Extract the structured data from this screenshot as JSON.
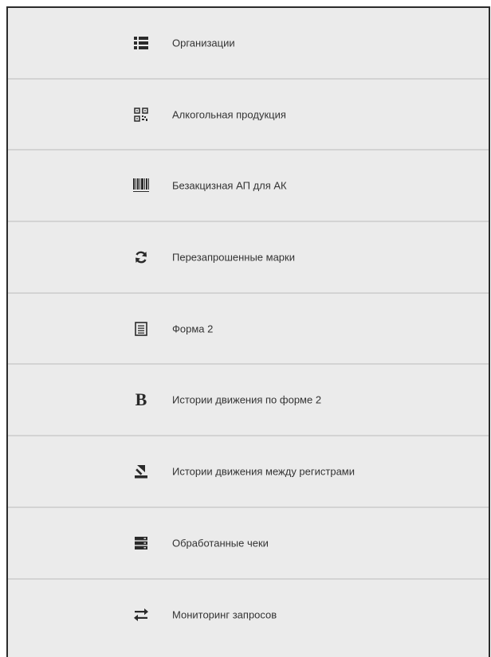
{
  "menu": {
    "items": [
      {
        "label": "Организации",
        "icon": "list-icon"
      },
      {
        "label": "Алкогольная продукция",
        "icon": "qr-code-icon"
      },
      {
        "label": "Безакцизная АП для АК",
        "icon": "barcode-icon"
      },
      {
        "label": "Перезапрошенные марки",
        "icon": "refresh-icon"
      },
      {
        "label": "Форма 2",
        "icon": "document-list-icon"
      },
      {
        "label": "Истории движения по форме 2",
        "icon": "bold-b-icon",
        "glyph": "B"
      },
      {
        "label": "Истории движения между регистрами",
        "icon": "upload-icon"
      },
      {
        "label": "Обработанные чеки",
        "icon": "server-stack-icon"
      },
      {
        "label": "Мониторинг запросов",
        "icon": "transfer-arrows-icon"
      }
    ]
  },
  "colors": {
    "panel_background": "#ebebeb",
    "divider": "#d3d3d3",
    "border": "#2b2b2b",
    "text": "#333333",
    "icon": "#2a2a2a"
  }
}
